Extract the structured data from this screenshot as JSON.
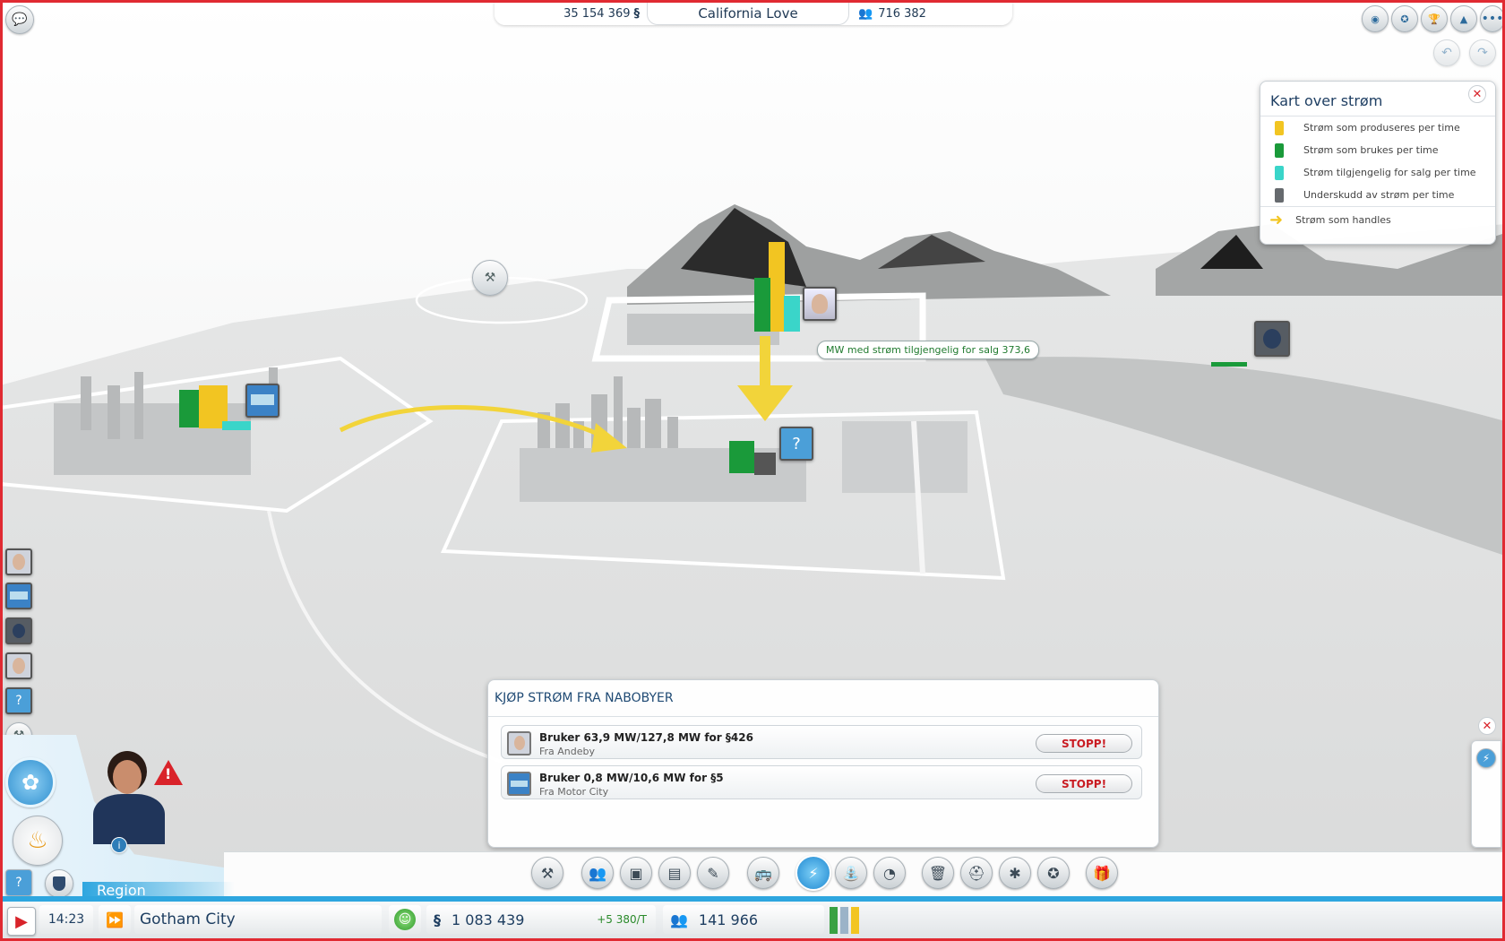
{
  "top": {
    "money": "35 154 369",
    "region_name": "California Love",
    "population": "716 382"
  },
  "legend": {
    "title": "Kart over strøm",
    "items": [
      {
        "label": "Strøm som produseres per time",
        "color": "#f2c522"
      },
      {
        "label": "Strøm som brukes per time",
        "color": "#1a9a3a"
      },
      {
        "label": "Strøm tilgjengelig for salg per time",
        "color": "#3ad5c9"
      },
      {
        "label": "Underskudd av strøm per time",
        "color": "#666a6e"
      }
    ],
    "arrow_label": "Strøm som handles",
    "arrow_color": "#f2c522"
  },
  "map": {
    "tooltip": "MW med strøm tilgjengelig for salg 373,6",
    "pin_label_a": "?"
  },
  "trade": {
    "title": "KJØP STRØM FRA NABOBYER",
    "rows": [
      {
        "usage": "Bruker 63,9 MW/127,8 MW for §426",
        "from": "Fra Andeby",
        "button": "STOPP!"
      },
      {
        "usage": "Bruker 0,8 MW/10,6 MW for §5",
        "from": "Fra Motor City",
        "button": "STOPP!"
      }
    ]
  },
  "bottom": {
    "region_tab": "Region",
    "time": "14:23",
    "city_name": "Gotham City",
    "funds": "1 083 439",
    "income": "+5 380/T",
    "population": "141 966"
  }
}
